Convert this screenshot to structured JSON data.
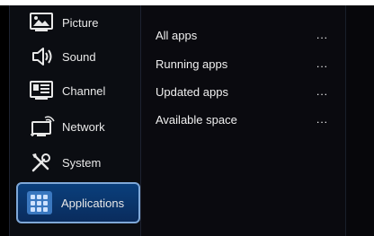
{
  "sidebar": {
    "items": [
      {
        "label": "Picture",
        "icon": "picture-icon"
      },
      {
        "label": "Sound",
        "icon": "speaker-icon"
      },
      {
        "label": "Channel",
        "icon": "channel-icon"
      },
      {
        "label": "Network",
        "icon": "network-icon"
      },
      {
        "label": "System",
        "icon": "tools-icon"
      },
      {
        "label": "Applications",
        "icon": "apps-icon",
        "selected": true
      }
    ]
  },
  "content": {
    "rows": [
      {
        "label": "All apps",
        "value": "..."
      },
      {
        "label": "Running apps",
        "value": "..."
      },
      {
        "label": "Updated apps",
        "value": "..."
      },
      {
        "label": "Available space",
        "value": "..."
      }
    ]
  },
  "colors": {
    "selected_bg": "#0a3f7c",
    "selected_border": "#7fa8d8",
    "background": "#000000",
    "text": "#f0f0f0"
  }
}
